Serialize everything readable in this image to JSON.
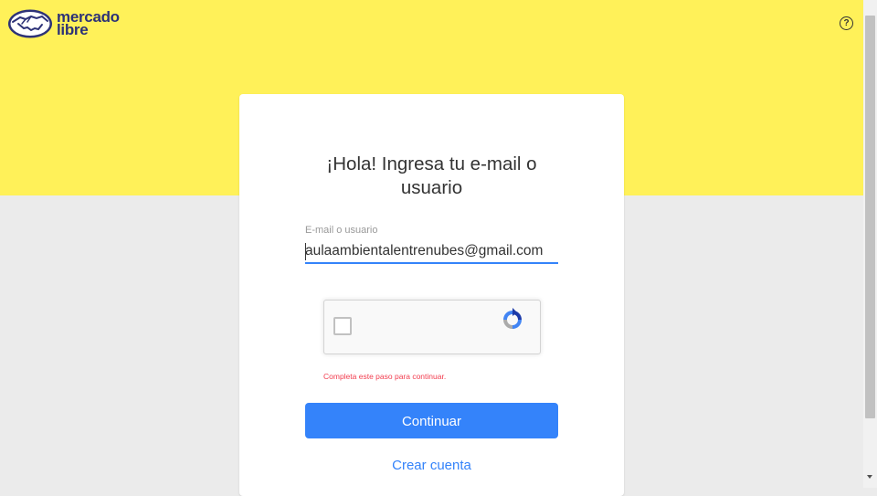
{
  "header": {
    "logo": {
      "line1": "mercado",
      "line2": "libre",
      "icon": "handshake-icon"
    },
    "help_icon": "help-circle-icon",
    "help_glyph": "?"
  },
  "login": {
    "title_line1": "¡Hola! Ingresa tu e-mail o",
    "title_line2": "usuario",
    "field_label": "E-mail o usuario",
    "field_value": "aulaambientalentrenubes@gmail.com",
    "error_message": "Completa este paso para continuar.",
    "continue_label": "Continuar",
    "create_account_label": "Crear cuenta"
  },
  "captcha": {
    "checked": false,
    "icon": "recaptcha-icon"
  },
  "colors": {
    "brand_yellow": "#fff159",
    "brand_navy": "#2d3277",
    "accent_blue": "#3483fa",
    "error_red": "#f23d4f",
    "background_gray": "#ebebeb"
  }
}
